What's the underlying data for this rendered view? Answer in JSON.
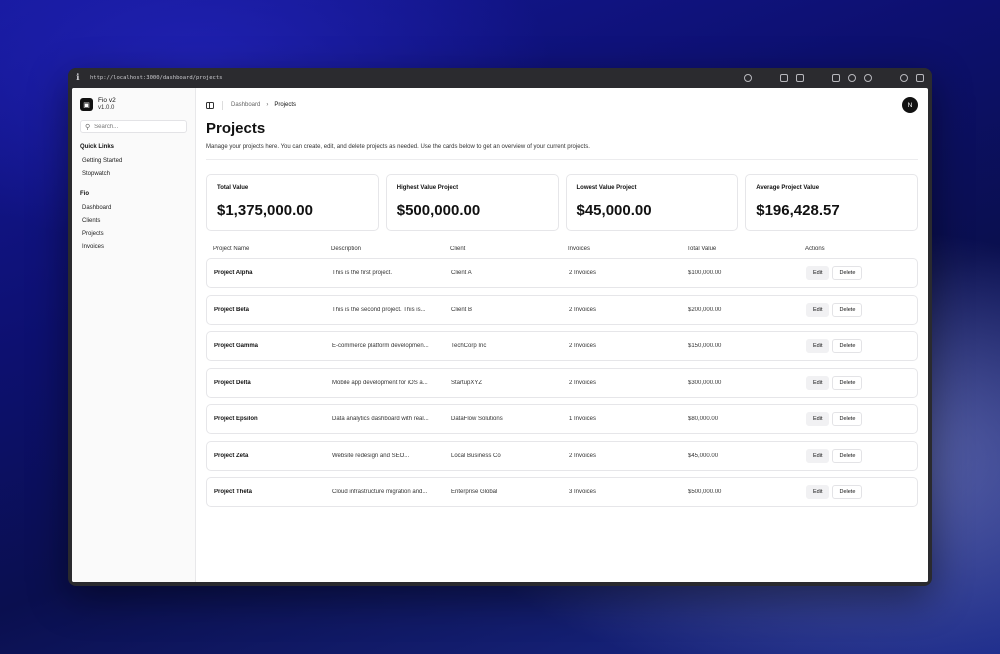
{
  "browser": {
    "url": "http://localhost:3000/dashboard/projects"
  },
  "sidebar": {
    "app_name": "Fio v2",
    "version": "v1.0.0",
    "search_placeholder": "Search...",
    "groups": [
      {
        "title": "Quick Links",
        "items": [
          "Getting Started",
          "Stopwatch"
        ]
      },
      {
        "title": "Fio",
        "items": [
          "Dashboard",
          "Clients",
          "Projects",
          "Invoices"
        ]
      }
    ]
  },
  "topbar": {
    "breadcrumb": [
      "Dashboard",
      "Projects"
    ],
    "avatar_initial": "N"
  },
  "page": {
    "title": "Projects",
    "description": "Manage your projects here. You can create, edit, and delete projects as needed. Use the cards below to get an overview of your current projects."
  },
  "cards": [
    {
      "label": "Total Value",
      "value": "$1,375,000.00"
    },
    {
      "label": "Highest Value Project",
      "value": "$500,000.00"
    },
    {
      "label": "Lowest Value Project",
      "value": "$45,000.00"
    },
    {
      "label": "Average Project Value",
      "value": "$196,428.57"
    }
  ],
  "table": {
    "columns": [
      "Project Name",
      "Description",
      "Client",
      "Invoices",
      "Total Value",
      "Actions"
    ],
    "edit_label": "Edit",
    "delete_label": "Delete",
    "rows": [
      {
        "name": "Project Alpha",
        "description": "This is the first project.",
        "client": "Client A",
        "invoices": "2 Invoices",
        "total": "$100,000.00"
      },
      {
        "name": "Project Beta",
        "description": "This is the second project. This is...",
        "client": "Client B",
        "invoices": "2 Invoices",
        "total": "$200,000.00"
      },
      {
        "name": "Project Gamma",
        "description": "E-commerce platform developmen...",
        "client": "TechCorp Inc",
        "invoices": "2 Invoices",
        "total": "$150,000.00"
      },
      {
        "name": "Project Delta",
        "description": "Mobile app development for iOS a...",
        "client": "StartupXYZ",
        "invoices": "2 Invoices",
        "total": "$300,000.00"
      },
      {
        "name": "Project Epsilon",
        "description": "Data analytics dashboard with real...",
        "client": "DataFlow Solutions",
        "invoices": "1 Invoices",
        "total": "$80,000.00"
      },
      {
        "name": "Project Zeta",
        "description": "Website redesign and SEO...",
        "client": "Local Business Co",
        "invoices": "2 Invoices",
        "total": "$45,000.00"
      },
      {
        "name": "Project Theta",
        "description": "Cloud infrastructure migration and...",
        "client": "Enterprise Global",
        "invoices": "3 Invoices",
        "total": "$500,000.00"
      }
    ]
  }
}
